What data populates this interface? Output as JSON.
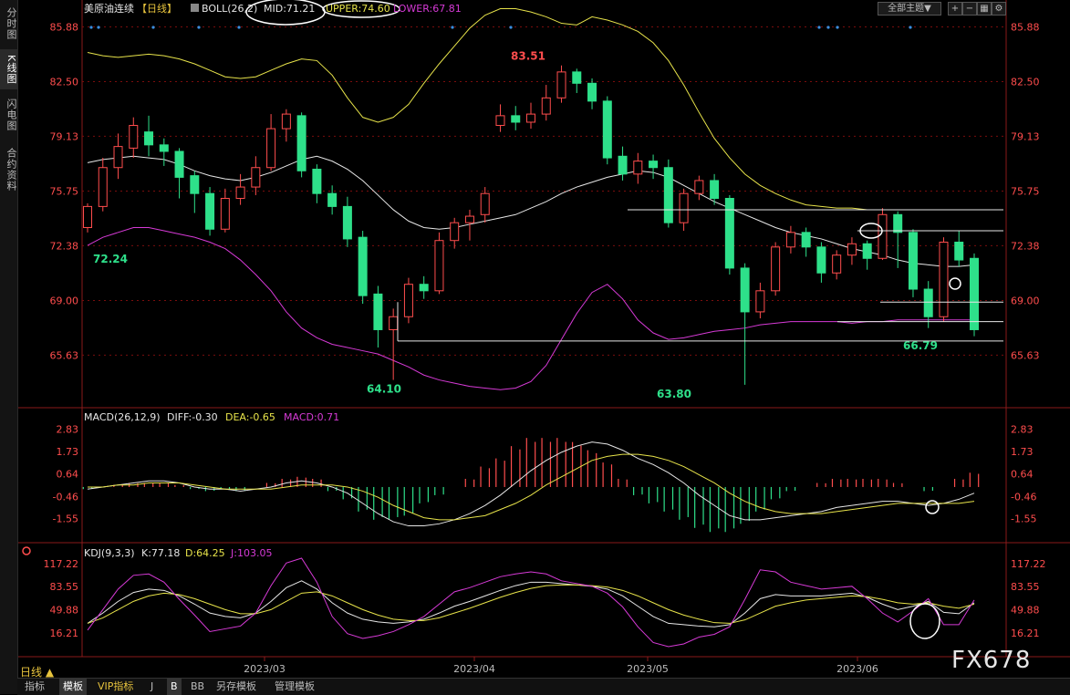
{
  "sidebar": {
    "tabs": [
      {
        "label": "分时图",
        "active": false
      },
      {
        "label": "K线图",
        "active": true
      },
      {
        "label": "闪电图",
        "active": false
      },
      {
        "label": "合约资料",
        "active": false
      }
    ]
  },
  "toolbar": {
    "theme_label": "全部主题▼",
    "icons": [
      "add-icon",
      "remove-icon",
      "grid-icon",
      "window-icon",
      "settings-icon"
    ]
  },
  "main_panel": {
    "title": "美原油连续",
    "period_tag": "【日线】",
    "indicator": "BOLL(26,2)",
    "mid": "MID:71.21",
    "upper": "UPPER:74.60",
    "lower": "LOWER:67.81"
  },
  "macd_panel": {
    "title": "MACD(26,12,9)",
    "diff": "DIFF:-0.30",
    "dea": "DEA:-0.65",
    "macd": "MACD:0.71"
  },
  "kdj_panel": {
    "title": "KDJ(9,3,3)",
    "k": "K:77.18",
    "d": "D:64.25",
    "j": "J:103.05"
  },
  "period_label": "日线 ▲",
  "bottom_tabs": [
    {
      "label": "指标",
      "active": false
    },
    {
      "label": "模板",
      "active": true
    },
    {
      "label": "VIP指标",
      "active": false
    },
    {
      "label": "J",
      "active": false
    },
    {
      "label": "B",
      "active": true
    },
    {
      "label": "BB",
      "active": false
    },
    {
      "label": "另存模板",
      "active": false
    },
    {
      "label": "管理模板",
      "active": false
    }
  ],
  "watermark": "FX678",
  "colors": {
    "up": "#ff4d4d",
    "down": "#2ee08a",
    "mid": "#e6e6e6",
    "upper": "#e7e34a",
    "lower": "#d63ad6",
    "axis": "#ff4d4d",
    "grid": "#7a0d0d"
  },
  "chart_data": [
    {
      "type": "candlestick",
      "title": "美原油连续",
      "yticks": [
        85.88,
        82.5,
        79.13,
        75.75,
        72.38,
        69.0,
        65.63
      ],
      "ylim": [
        62.5,
        86.3
      ],
      "xticks": [
        "2023/03",
        "2023/04",
        "2023/05",
        "2023/06"
      ],
      "annotations": [
        "83.51",
        "72.24",
        "64.10",
        "63.80",
        "66.79"
      ],
      "series": [
        {
          "name": "MID",
          "values": [
            77.5,
            77.7,
            77.8,
            77.9,
            77.8,
            77.7,
            77.4,
            77.0,
            76.7,
            76.5,
            76.4,
            76.6,
            76.9,
            77.3,
            77.7,
            77.9,
            77.6,
            77.1,
            76.4,
            75.5,
            74.6,
            73.9,
            73.5,
            73.4,
            73.5,
            73.7,
            73.9,
            74.1,
            74.3,
            74.7,
            75.1,
            75.6,
            76.0,
            76.3,
            76.6,
            76.8,
            77.0,
            76.9,
            76.6,
            76.1,
            75.6,
            75.1,
            74.7,
            74.3,
            73.9,
            73.5,
            73.2,
            73.0,
            72.8,
            72.5,
            72.2,
            72.0,
            71.8,
            71.5,
            71.3,
            71.2,
            71.1,
            71.1,
            71.2
          ]
        },
        {
          "name": "UPPER",
          "values": [
            84.3,
            84.1,
            84.0,
            84.1,
            84.2,
            84.1,
            83.9,
            83.6,
            83.2,
            82.8,
            82.7,
            82.8,
            83.2,
            83.6,
            83.9,
            83.8,
            82.9,
            81.5,
            80.3,
            80.0,
            80.3,
            81.1,
            82.4,
            83.6,
            84.7,
            85.8,
            86.6,
            87.0,
            87.0,
            86.8,
            86.5,
            86.1,
            86.0,
            86.5,
            86.3,
            86.0,
            85.6,
            84.9,
            83.8,
            82.3,
            80.6,
            79.0,
            77.8,
            76.8,
            76.1,
            75.6,
            75.2,
            74.9,
            74.8,
            74.7,
            74.7,
            74.6,
            74.6,
            74.6,
            74.6,
            74.6,
            74.6,
            74.6,
            74.6
          ]
        },
        {
          "name": "LOWER",
          "values": [
            72.4,
            72.9,
            73.2,
            73.5,
            73.5,
            73.3,
            73.1,
            72.9,
            72.6,
            72.2,
            71.5,
            70.6,
            69.6,
            68.3,
            67.3,
            66.7,
            66.3,
            66.1,
            65.9,
            65.7,
            65.3,
            64.9,
            64.4,
            64.1,
            63.9,
            63.7,
            63.6,
            63.5,
            63.6,
            64.0,
            65.0,
            66.6,
            68.2,
            69.5,
            70.0,
            69.1,
            67.8,
            67.0,
            66.6,
            66.7,
            66.9,
            67.1,
            67.2,
            67.3,
            67.5,
            67.6,
            67.7,
            67.7,
            67.7,
            67.7,
            67.6,
            67.7,
            67.7,
            67.8,
            67.8,
            67.8,
            67.8,
            67.8,
            67.8
          ]
        }
      ],
      "candles": [
        [
          73.5,
          74.8,
          75.0,
          73.2
        ],
        [
          74.8,
          77.2,
          77.8,
          74.5
        ],
        [
          77.2,
          78.5,
          79.3,
          76.5
        ],
        [
          78.4,
          79.8,
          80.3,
          77.8
        ],
        [
          79.4,
          78.6,
          80.4,
          77.9
        ],
        [
          78.6,
          78.2,
          79.0,
          77.3
        ],
        [
          78.2,
          76.6,
          78.4,
          75.3
        ],
        [
          76.7,
          75.6,
          77.0,
          74.4
        ],
        [
          75.6,
          73.4,
          76.0,
          73.0
        ],
        [
          73.4,
          75.3,
          75.9,
          73.2
        ],
        [
          75.3,
          76.0,
          76.8,
          74.9
        ],
        [
          76.0,
          77.2,
          77.9,
          75.5
        ],
        [
          77.2,
          79.6,
          80.5,
          77.0
        ],
        [
          79.6,
          80.5,
          80.8,
          78.8
        ],
        [
          80.4,
          77.0,
          80.6,
          76.6
        ],
        [
          77.1,
          75.6,
          77.4,
          75.0
        ],
        [
          75.6,
          74.8,
          76.1,
          74.3
        ],
        [
          74.8,
          72.8,
          75.4,
          72.3
        ],
        [
          72.9,
          69.3,
          73.3,
          68.8
        ],
        [
          69.4,
          67.2,
          69.9,
          66.1
        ],
        [
          67.2,
          68.0,
          68.5,
          64.1
        ],
        [
          68.0,
          70.0,
          70.4,
          67.6
        ],
        [
          70.0,
          69.6,
          70.5,
          69.1
        ],
        [
          69.6,
          72.7,
          73.2,
          69.4
        ],
        [
          72.7,
          73.8,
          74.1,
          72.2
        ],
        [
          73.8,
          74.2,
          74.6,
          72.7
        ],
        [
          74.3,
          75.6,
          76.0,
          73.8
        ],
        [
          79.8,
          80.4,
          81.1,
          79.4
        ],
        [
          80.4,
          80.0,
          81.0,
          79.5
        ],
        [
          80.0,
          80.5,
          81.2,
          79.6
        ],
        [
          80.5,
          81.5,
          82.3,
          80.1
        ],
        [
          81.5,
          83.1,
          83.5,
          81.2
        ],
        [
          83.1,
          82.4,
          83.3,
          81.8
        ],
        [
          82.4,
          81.3,
          82.7,
          80.8
        ],
        [
          81.3,
          77.8,
          81.6,
          77.4
        ],
        [
          77.9,
          76.8,
          78.5,
          76.4
        ],
        [
          76.8,
          77.6,
          78.1,
          76.2
        ],
        [
          77.6,
          77.2,
          78.0,
          76.5
        ],
        [
          77.2,
          73.8,
          77.7,
          73.5
        ],
        [
          73.8,
          75.6,
          75.9,
          73.3
        ],
        [
          75.6,
          76.4,
          76.7,
          75.2
        ],
        [
          76.4,
          75.3,
          76.8,
          74.9
        ],
        [
          75.3,
          71.0,
          75.5,
          70.6
        ],
        [
          71.0,
          68.3,
          71.3,
          63.8
        ],
        [
          68.3,
          69.6,
          70.1,
          67.9
        ],
        [
          69.6,
          72.3,
          72.6,
          69.3
        ],
        [
          72.3,
          73.2,
          73.6,
          71.9
        ],
        [
          73.2,
          72.3,
          73.5,
          71.7
        ],
        [
          72.3,
          70.7,
          72.6,
          70.1
        ],
        [
          70.7,
          71.8,
          72.1,
          70.3
        ],
        [
          71.8,
          72.5,
          72.9,
          71.2
        ],
        [
          72.5,
          71.6,
          72.7,
          70.9
        ],
        [
          71.6,
          74.3,
          74.7,
          71.5
        ],
        [
          74.3,
          73.2,
          74.5,
          71.0
        ],
        [
          73.2,
          69.7,
          73.4,
          69.2
        ],
        [
          69.7,
          68.0,
          70.2,
          67.3
        ],
        [
          68.0,
          72.6,
          72.9,
          67.7
        ],
        [
          72.6,
          71.5,
          73.3,
          71.1
        ],
        [
          71.6,
          67.2,
          71.9,
          66.8
        ]
      ]
    },
    {
      "type": "bar+line",
      "title": "MACD(26,12,9)",
      "yticks": [
        2.83,
        1.73,
        0.64,
        -0.46,
        -1.55
      ],
      "ylim": [
        -2.5,
        3.3
      ],
      "series": [
        {
          "name": "DIFF",
          "values": [
            -0.1,
            0.0,
            0.1,
            0.2,
            0.3,
            0.3,
            0.2,
            0.0,
            -0.1,
            -0.1,
            -0.2,
            -0.1,
            0.0,
            0.2,
            0.3,
            0.2,
            0.0,
            -0.3,
            -0.8,
            -1.3,
            -1.7,
            -1.9,
            -1.9,
            -1.8,
            -1.6,
            -1.3,
            -0.9,
            -0.4,
            0.2,
            0.8,
            1.3,
            1.7,
            2.0,
            2.2,
            2.1,
            1.8,
            1.4,
            1.1,
            0.7,
            0.2,
            -0.4,
            -0.9,
            -1.4,
            -1.6,
            -1.6,
            -1.5,
            -1.4,
            -1.3,
            -1.2,
            -1.0,
            -0.9,
            -0.8,
            -0.7,
            -0.7,
            -0.8,
            -0.9,
            -0.8,
            -0.6,
            -0.3
          ]
        },
        {
          "name": "DEA",
          "values": [
            0.0,
            0.0,
            0.1,
            0.1,
            0.2,
            0.2,
            0.2,
            0.1,
            0.0,
            -0.1,
            -0.1,
            -0.1,
            -0.1,
            0.0,
            0.1,
            0.1,
            0.1,
            0.0,
            -0.2,
            -0.5,
            -0.9,
            -1.2,
            -1.5,
            -1.6,
            -1.6,
            -1.5,
            -1.4,
            -1.1,
            -0.8,
            -0.4,
            0.1,
            0.5,
            0.9,
            1.3,
            1.5,
            1.6,
            1.6,
            1.5,
            1.3,
            1.0,
            0.6,
            0.2,
            -0.3,
            -0.7,
            -1.0,
            -1.2,
            -1.3,
            -1.3,
            -1.3,
            -1.2,
            -1.1,
            -1.0,
            -0.9,
            -0.8,
            -0.8,
            -0.8,
            -0.8,
            -0.8,
            -0.7
          ]
        },
        {
          "name": "MACD",
          "values": [
            -0.1,
            0.0,
            0.1,
            0.2,
            0.2,
            0.2,
            0.1,
            -0.1,
            -0.2,
            -0.1,
            -0.2,
            0.0,
            0.2,
            0.4,
            0.5,
            0.4,
            -0.2,
            -0.6,
            -1.2,
            -1.6,
            -1.6,
            -1.4,
            -0.8,
            -0.4,
            0.0,
            0.4,
            1.0,
            1.4,
            2.0,
            2.4,
            2.4,
            2.4,
            2.2,
            1.8,
            1.2,
            0.4,
            -0.4,
            -0.8,
            -1.2,
            -1.6,
            -2.0,
            -2.2,
            -2.2,
            -1.8,
            -1.2,
            -0.6,
            -0.2,
            0.0,
            0.2,
            0.4,
            0.4,
            0.4,
            0.4,
            0.2,
            0.0,
            -0.2,
            0.0,
            0.4,
            0.7
          ]
        }
      ]
    },
    {
      "type": "line",
      "title": "KDJ(9,3,3)",
      "yticks": [
        117.22,
        83.55,
        49.88,
        16.21
      ],
      "ylim": [
        -8,
        125
      ],
      "series": [
        {
          "name": "K",
          "values": [
            30,
            45,
            62,
            75,
            80,
            78,
            70,
            58,
            45,
            40,
            38,
            45,
            62,
            82,
            92,
            80,
            60,
            45,
            36,
            32,
            30,
            32,
            36,
            45,
            55,
            62,
            70,
            78,
            85,
            90,
            90,
            88,
            86,
            84,
            80,
            70,
            55,
            40,
            30,
            28,
            26,
            25,
            28,
            45,
            66,
            72,
            70,
            70,
            70,
            72,
            74,
            68,
            58,
            50,
            55,
            62,
            46,
            44,
            60
          ]
        },
        {
          "name": "D",
          "values": [
            30,
            38,
            50,
            62,
            70,
            74,
            72,
            66,
            58,
            50,
            44,
            44,
            50,
            62,
            74,
            76,
            70,
            60,
            50,
            42,
            36,
            34,
            34,
            38,
            45,
            52,
            60,
            68,
            75,
            81,
            85,
            86,
            86,
            85,
            83,
            78,
            70,
            60,
            50,
            42,
            36,
            31,
            30,
            35,
            45,
            55,
            60,
            64,
            66,
            68,
            70,
            69,
            65,
            60,
            58,
            60,
            55,
            52,
            58
          ]
        },
        {
          "name": "J",
          "values": [
            20,
            50,
            80,
            100,
            102,
            90,
            65,
            42,
            18,
            22,
            26,
            45,
            85,
            118,
            125,
            90,
            40,
            15,
            8,
            12,
            18,
            28,
            40,
            58,
            76,
            82,
            90,
            98,
            102,
            105,
            102,
            92,
            88,
            84,
            74,
            54,
            25,
            2,
            -4,
            0,
            10,
            14,
            25,
            65,
            108,
            105,
            90,
            85,
            80,
            82,
            84,
            66,
            45,
            32,
            48,
            66,
            28,
            28,
            64
          ]
        }
      ]
    }
  ]
}
